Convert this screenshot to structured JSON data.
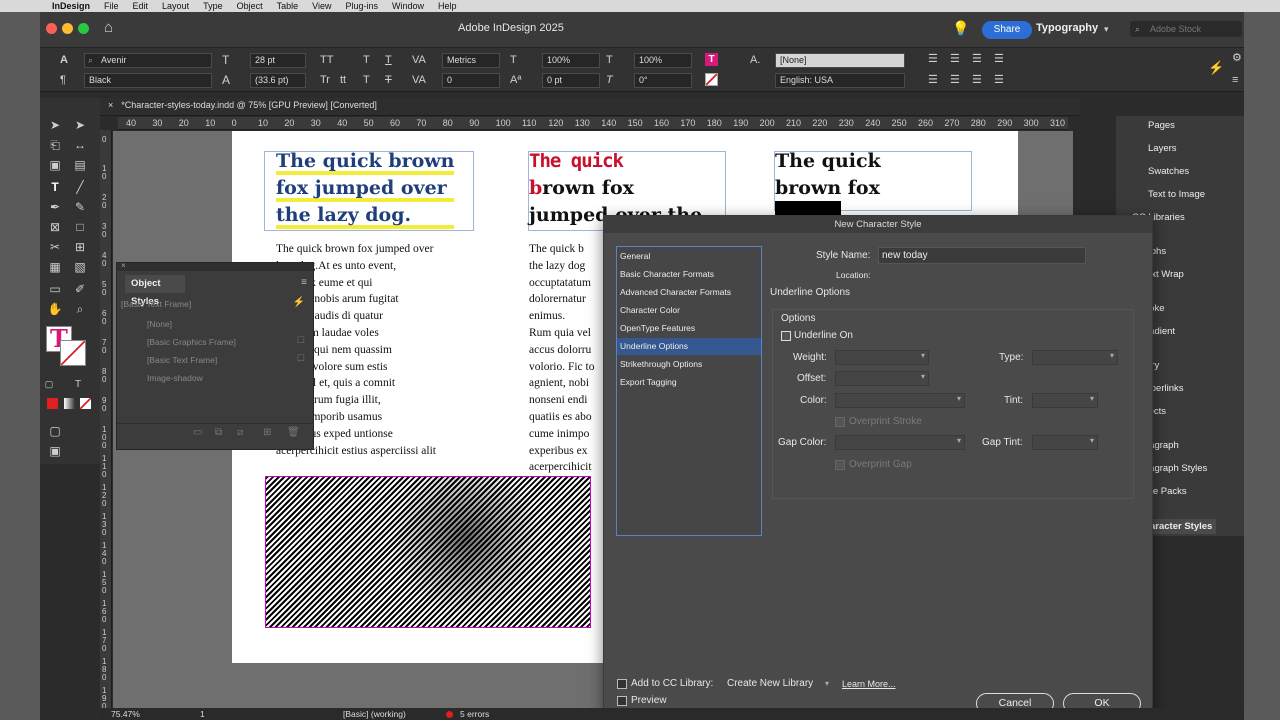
{
  "menubar": {
    "app": "InDesign",
    "items": [
      "File",
      "Edit",
      "Layout",
      "Type",
      "Object",
      "Table",
      "View",
      "Plug-ins",
      "Window",
      "Help"
    ]
  },
  "titlebar": {
    "title": "Adobe InDesign 2025",
    "share": "Share",
    "workspace": "Typography",
    "search_placeholder": "Adobe Stock"
  },
  "control": {
    "font": "Avenir",
    "style": "Black",
    "size": "28 pt",
    "leading": "(33.6 pt)",
    "kerning": "Metrics",
    "tracking": "0",
    "hscale": "100%",
    "vscale": "100%",
    "baseline": "0 pt",
    "skew": "0°",
    "char_style": "[None]",
    "language": "English: USA",
    "tt1": "TT",
    "t1": "T",
    "tr": "Tr",
    "tt2": "tt",
    "t2": "T"
  },
  "document": {
    "tab": "*Character-styles-today.indd @ 75% [GPU Preview] [Converted]"
  },
  "ruler_ticks": [
    "40",
    "30",
    "20",
    "10",
    "0",
    "10",
    "20",
    "30",
    "40",
    "50",
    "60",
    "70",
    "80",
    "90",
    "100",
    "110",
    "120",
    "130",
    "140",
    "150",
    "160",
    "170",
    "180",
    "190",
    "200",
    "210",
    "220",
    "230",
    "240",
    "250",
    "260",
    "270",
    "280",
    "290",
    "300",
    "310"
  ],
  "vruler_ticks": [
    "0",
    "1 0",
    "2 0",
    "3 0",
    "4 0",
    "5 0",
    "6 0",
    "7 0",
    "8 0",
    "9 0",
    "1 0 0",
    "1 1 0",
    "1 2 0",
    "1 3 0",
    "1 4 0",
    "1 5 0",
    "1 6 0",
    "1 7 0",
    "1 8 0",
    "1 9 0"
  ],
  "page": {
    "col1_head": [
      "The quick brown",
      "fox jumped over",
      "the lazy dog."
    ],
    "col2_head_red": [
      "The quick",
      "b"
    ],
    "col2_head_black": [
      "rown fox",
      "jumped over the"
    ],
    "col3_head": [
      "The quick",
      "brown fox"
    ],
    "col1_body": [
      "The quick brown fox jumped over",
      "lazy dog.At es unto event,",
      "tatum ex eume et qui",
      "natur re nobis arum fugitat",
      "ia vel is audis di quatur",
      "dolorrum laudae voles",
      "Fic totatqui nem quassim",
      "t, nobis volore sum estis",
      "endicipil et, quis a comnit",
      "es aborerum fugia illit,",
      "impor emporib usamus",
      "experibus exped untionse",
      "acerpercihicit estius asperciissi alit"
    ],
    "col2_body": [
      "The quick b",
      "the lazy dog",
      "occuptatatum",
      "dolorernatur",
      "enimus.",
      "Rum quia vel",
      "accus dolorru",
      "volorio. Fic to",
      "agnient, nobi",
      "nonseni endi",
      "quatiis es abo",
      "cume inimpo",
      "experibus ex",
      "acerpercihicit"
    ],
    "colors": {
      "col1": "#1f3f7a",
      "col2_red": "#c8102e",
      "col3_red": "#c8102e"
    }
  },
  "object_styles": {
    "title": "Object Styles",
    "items": [
      "[Basic Text Frame]",
      "[None]",
      "[Basic Graphics Frame]",
      "[Basic Text Frame]",
      "Image-shadow"
    ]
  },
  "dialog": {
    "title": "New Character Style",
    "categories": [
      "General",
      "Basic Character Formats",
      "Advanced Character Formats",
      "Character Color",
      "OpenType Features",
      "Underline Options",
      "Strikethrough Options",
      "Export Tagging"
    ],
    "selected_category": "Underline Options",
    "style_name_label": "Style Name:",
    "style_name": "new today",
    "location_label": "Location:",
    "section": "Underline Options",
    "options_label": "Options",
    "underline_on": "Underline On",
    "weight": "Weight:",
    "type": "Type:",
    "offset": "Offset:",
    "color": "Color:",
    "tint": "Tint:",
    "overprint_stroke": "Overprint Stroke",
    "gap_color": "Gap Color:",
    "gap_tint": "Gap Tint:",
    "overprint_gap": "Overprint Gap",
    "add_cc": "Add to CC Library:",
    "cc_value": "Create New Library",
    "learn_more": "Learn More...",
    "preview": "Preview",
    "cancel": "Cancel",
    "ok": "OK"
  },
  "dock": {
    "items": [
      "Pages",
      "Layers",
      "Swatches",
      "Text to Image",
      "CC Libraries",
      "yphs",
      "ext Wrap",
      "roke",
      "radient",
      "ory",
      "yperlinks",
      "fects",
      "ragraph",
      "ragraph Styles",
      "yle Packs",
      "aracter Styles"
    ]
  },
  "status": {
    "zoom": "75.47%",
    "page": "1",
    "style": "[Basic] (working)",
    "errors": "5 errors"
  }
}
